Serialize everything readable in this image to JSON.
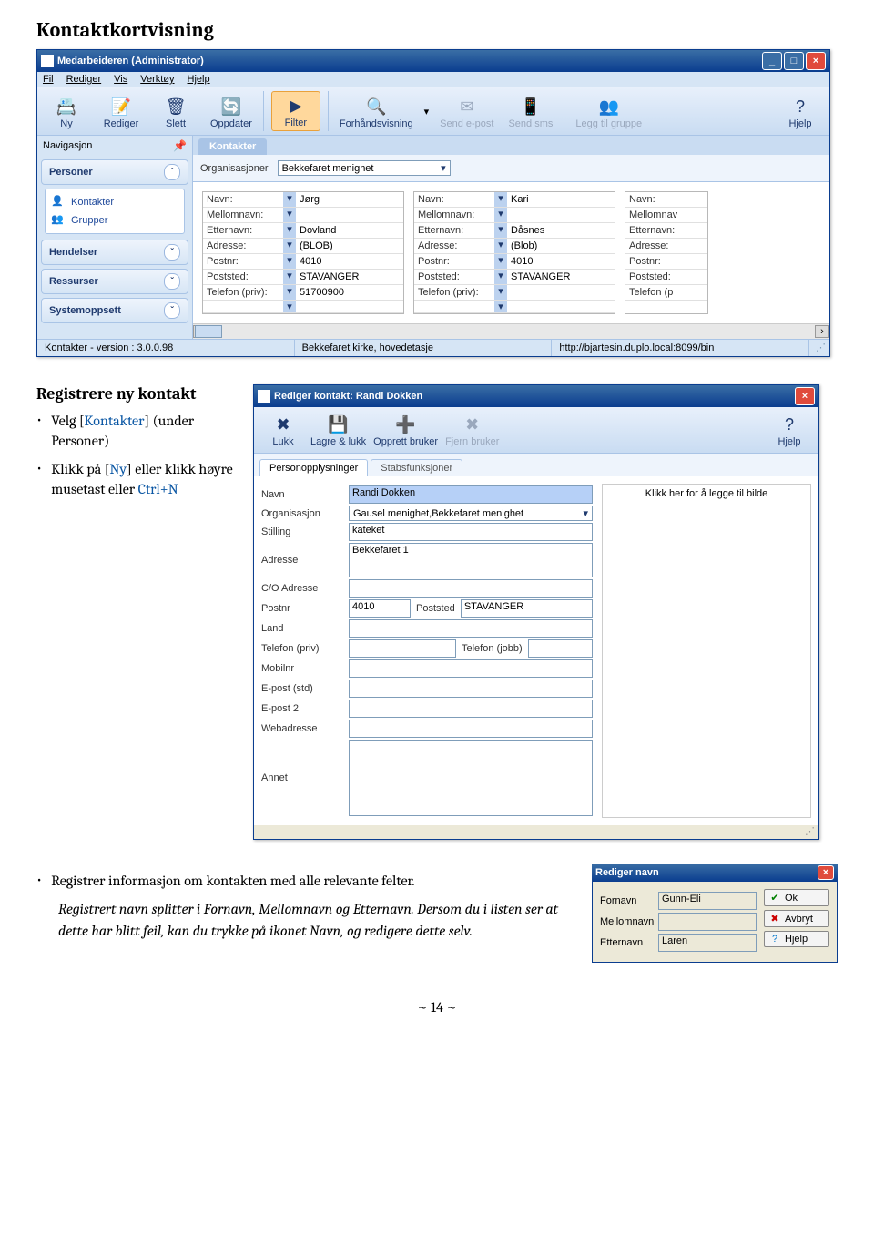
{
  "heading": "Kontaktkortvisning",
  "main_window": {
    "title": "Medarbeideren (Administrator)",
    "menubar": [
      "Fil",
      "Rediger",
      "Vis",
      "Verktøy",
      "Hjelp"
    ],
    "toolbar": [
      {
        "label": "Ny",
        "icon": "📇",
        "name": "ny-button"
      },
      {
        "label": "Rediger",
        "icon": "📝",
        "name": "rediger-button"
      },
      {
        "label": "Slett",
        "icon": "🗑",
        "name": "slett-button"
      },
      {
        "label": "Oppdater",
        "icon": "🔄",
        "name": "oppdater-button"
      },
      {
        "label": "Filter",
        "icon": "▶",
        "name": "filter-button",
        "active": true
      },
      {
        "label": "Forhåndsvisning",
        "icon": "🔍",
        "name": "forhandsvisning-button",
        "big": true
      },
      {
        "label": "Send e-post",
        "icon": "✉",
        "name": "send-epost-button",
        "disabled": true
      },
      {
        "label": "Send sms",
        "icon": "📱",
        "name": "send-sms-button",
        "disabled": true
      },
      {
        "label": "Legg til gruppe",
        "icon": "👥",
        "name": "legg-til-gruppe-button",
        "disabled": true,
        "big": true
      },
      {
        "label": "Hjelp",
        "icon": "?",
        "name": "hjelp-button"
      }
    ],
    "nav_header": "Navigasjon",
    "nav_groups": {
      "personer": {
        "title": "Personer",
        "items": [
          {
            "label": "Kontakter",
            "icon": "👤"
          },
          {
            "label": "Grupper",
            "icon": "👥"
          }
        ]
      },
      "hendelser": "Hendelser",
      "ressurser": "Ressurser",
      "systemoppsett": "Systemoppsett"
    },
    "tab": "Kontakter",
    "filter": {
      "label": "Organisasjoner",
      "value": "Bekkefaret menighet"
    },
    "card_labels": {
      "navn": "Navn:",
      "mellomnavn": "Mellomnavn:",
      "etternavn": "Etternavn:",
      "adresse": "Adresse:",
      "postnr": "Postnr:",
      "poststed": "Poststed:",
      "telefon": "Telefon (priv):"
    },
    "cards": [
      {
        "navn": "Jørg",
        "mellomnavn": "",
        "etternavn": "Dovland",
        "adresse": "(BLOB)",
        "postnr": "4010",
        "poststed": "STAVANGER",
        "telefon": "51700900"
      },
      {
        "navn": "Kari",
        "mellomnavn": "",
        "etternavn": "Dåsnes",
        "adresse": "(Blob)",
        "postnr": "4010",
        "poststed": "STAVANGER",
        "telefon": ""
      }
    ],
    "card3_labels": {
      "navn": "Navn:",
      "mellomnavn": "Mellomnav",
      "etternavn": "Etternavn:",
      "adresse": "Adresse:",
      "postnr": "Postnr:",
      "poststed": "Poststed:",
      "telefon": "Telefon (p"
    },
    "status": {
      "left": "Kontakter - version : 3.0.0.98",
      "mid": "Bekkefaret kirke, hovedetasje",
      "right": "http://bjartesin.duplo.local:8099/bin"
    }
  },
  "left_text": {
    "heading": "Registrere ny kontakt",
    "b1_pre": "Velg [",
    "b1_link": "Kontakter",
    "b1_post": "] (under Personer)",
    "b2_pre": "Klikk på [",
    "b2_link": "Ny",
    "b2_post": "] eller klikk høyre musetast eller ",
    "b2_link2": "Ctrl+N"
  },
  "edit_dialog": {
    "title": "Rediger kontakt: Randi Dokken",
    "toolbar": [
      {
        "label": "Lukk",
        "icon": "✖",
        "name": "lukk-button"
      },
      {
        "label": "Lagre & lukk",
        "icon": "💾",
        "name": "lagre-lukk-button"
      },
      {
        "label": "Opprett bruker",
        "icon": "➕",
        "name": "opprett-bruker-button"
      },
      {
        "label": "Fjern bruker",
        "icon": "✖",
        "name": "fjern-bruker-button",
        "disabled": true
      },
      {
        "label": "Hjelp",
        "icon": "?",
        "name": "hjelp-button-dialog"
      }
    ],
    "tabs": {
      "active": "Personopplysninger",
      "other": "Stabsfunksjoner"
    },
    "fields": {
      "navn": {
        "label": "Navn",
        "value": "Randi Dokken"
      },
      "organisasjon": {
        "label": "Organisasjon",
        "value": "Gausel menighet,Bekkefaret menighet"
      },
      "stilling": {
        "label": "Stilling",
        "value": "kateket"
      },
      "adresse": {
        "label": "Adresse",
        "value": "Bekkefaret 1"
      },
      "co": {
        "label": "C/O Adresse",
        "value": ""
      },
      "postnr": {
        "label": "Postnr",
        "value": "4010"
      },
      "poststed": {
        "label": "Poststed",
        "value": "STAVANGER"
      },
      "land": {
        "label": "Land",
        "value": ""
      },
      "telpriv": {
        "label": "Telefon (priv)",
        "value": ""
      },
      "teljobb": {
        "label": "Telefon (jobb)",
        "value": ""
      },
      "mobil": {
        "label": "Mobilnr",
        "value": ""
      },
      "eposts": {
        "label": "E-post (std)",
        "value": ""
      },
      "epost2": {
        "label": "E-post 2",
        "value": ""
      },
      "web": {
        "label": "Webadresse",
        "value": ""
      },
      "annet": {
        "label": "Annet",
        "value": ""
      }
    },
    "image_hint": "Klikk her for å legge til bilde"
  },
  "bottom": {
    "bullet1": "Registrer informasjon om kontakten med alle relevante felter.",
    "italic": "Registrert navn splitter i Fornavn, Mellomnavn og Etternavn. Dersom du i listen ser at dette har blitt feil, kan du trykke på ikonet Navn, og redigere dette selv."
  },
  "rename_dialog": {
    "title": "Rediger navn",
    "fields": {
      "fornavn": {
        "label": "Fornavn",
        "value": "Gunn-Eli"
      },
      "mellomnavn": {
        "label": "Mellomnavn",
        "value": ""
      },
      "etternavn": {
        "label": "Etternavn",
        "value": "Laren"
      }
    },
    "buttons": {
      "ok": "Ok",
      "avbryt": "Avbryt",
      "hjelp": "Hjelp"
    }
  },
  "page_num": "~ 14 ~"
}
